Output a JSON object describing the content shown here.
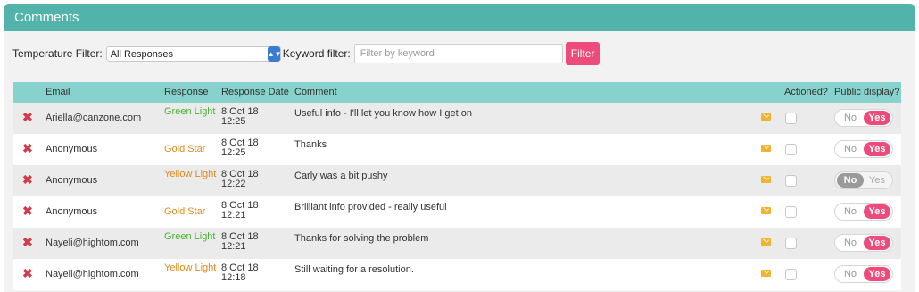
{
  "header": {
    "title": "Comments"
  },
  "filters": {
    "temperature_label": "Temperature Filter:",
    "temperature_value": "All Responses",
    "keyword_label": "Keyword filter:",
    "keyword_placeholder": "Filter by keyword",
    "keyword_value": "",
    "filter_button": "Filter"
  },
  "table": {
    "columns": [
      "Email",
      "Response",
      "Response Date",
      "Comment",
      "Actioned?",
      "Public display?"
    ],
    "rows": [
      {
        "email": "Ariella@canzone.com",
        "response": "Green Light",
        "response_color": "#4cb233",
        "date_line1": "8 Oct 18",
        "date_line2": "12:25",
        "comment": "Useful info - I'll let you know how I get on",
        "public": "Yes"
      },
      {
        "email": "Anonymous",
        "response": "Gold Star",
        "response_color": "#e08a1e",
        "date_line1": "8 Oct 18",
        "date_line2": "12:25",
        "comment": "Thanks",
        "public": "Yes"
      },
      {
        "email": "Anonymous",
        "response": "Yellow Light",
        "response_color": "#e08a1e",
        "date_line1": "8 Oct 18",
        "date_line2": "12:22",
        "comment": "Carly was a bit pushy",
        "public": "No"
      },
      {
        "email": "Anonymous",
        "response": "Gold Star",
        "response_color": "#e08a1e",
        "date_line1": "8 Oct 18",
        "date_line2": "12:21",
        "comment": "Brilliant info provided - really useful",
        "public": "Yes"
      },
      {
        "email": "Nayeli@hightom.com",
        "response": "Green Light",
        "response_color": "#4cb233",
        "date_line1": "8 Oct 18",
        "date_line2": "12:21",
        "comment": "Thanks for solving the problem",
        "public": "Yes"
      },
      {
        "email": "Nayeli@hightom.com",
        "response": "Yellow Light",
        "response_color": "#e08a1e",
        "date_line1": "8 Oct 18",
        "date_line2": "12:18",
        "comment": "Still waiting for a resolution.",
        "public": "Yes"
      }
    ],
    "toggle_no": "No",
    "toggle_yes": "Yes"
  },
  "colors": {
    "header": "#52b3aa",
    "table_header": "#87d2cc",
    "accent": "#ee4b7d",
    "delete": "#d43a4a",
    "mail": "#f0b430"
  },
  "icons": {
    "delete": "delete-icon",
    "mail": "mail-icon",
    "select_arrow": "chevron-updown-icon"
  }
}
